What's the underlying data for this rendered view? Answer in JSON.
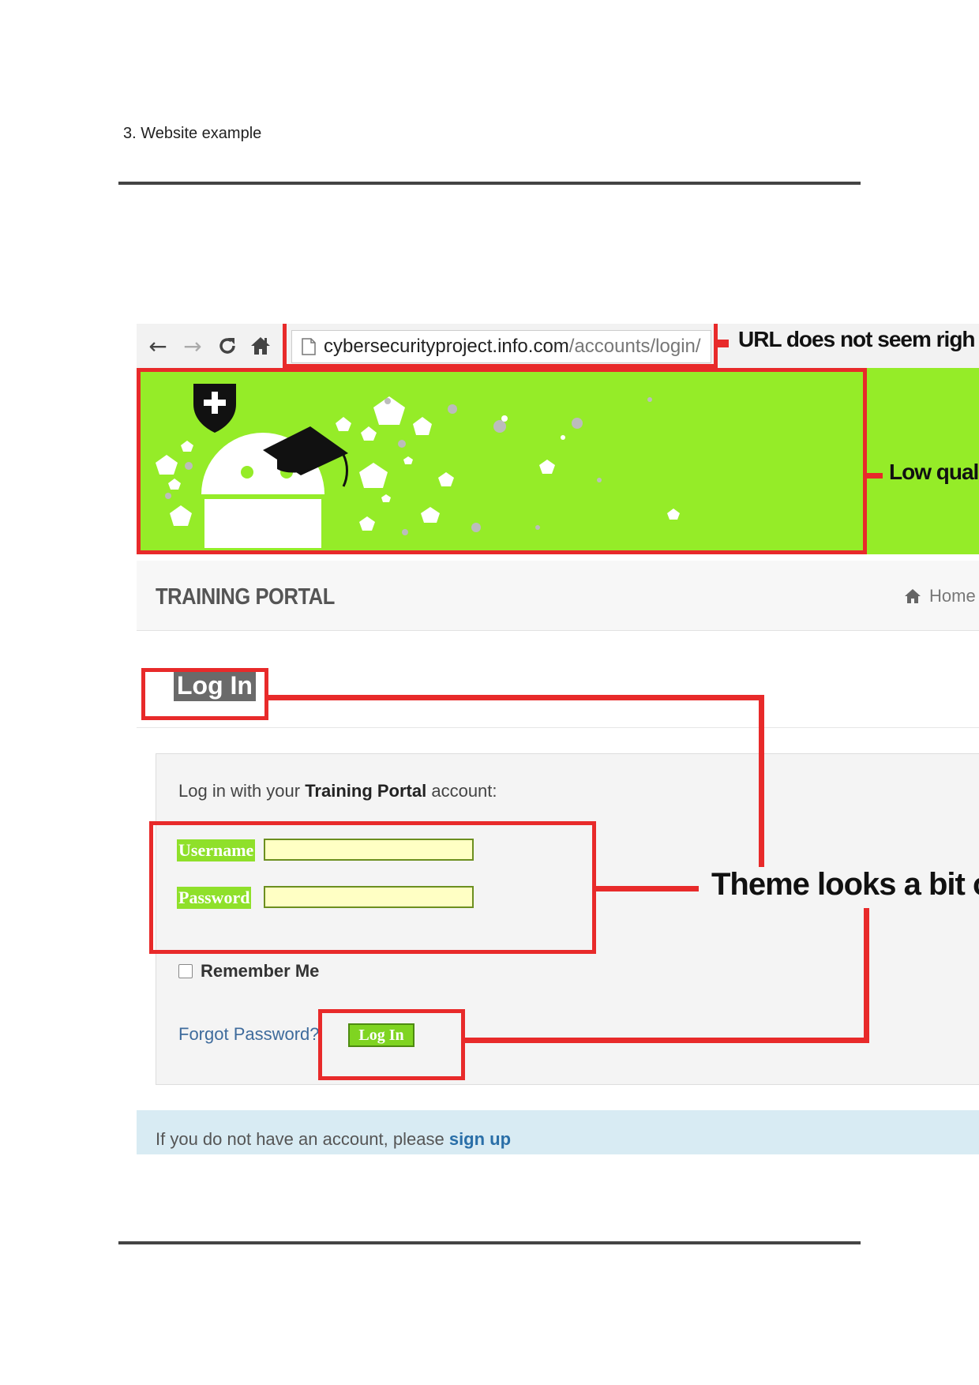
{
  "document": {
    "heading": "3. Website example"
  },
  "browser": {
    "url_host": "cybersecurityproject.info.com",
    "url_path": "/accounts/login/"
  },
  "portal": {
    "title": "TRAINING PORTAL",
    "home_link": "Home"
  },
  "login": {
    "heading": "Log In",
    "prompt_prefix": "Log in with your ",
    "prompt_bold": "Training Portal",
    "prompt_suffix": " account:",
    "username_label": "Username",
    "password_label": "Password",
    "username_value": "",
    "password_value": "",
    "remember_label": "Remember Me",
    "remember_checked": false,
    "forgot_label": "Forgot Password?",
    "button_label": "Log In"
  },
  "signup": {
    "text": "If you do not have an account, please ",
    "link": "sign up"
  },
  "annotations": {
    "url": "URL does not seem righ",
    "banner": "Low qual",
    "theme": "Theme looks a bit o"
  },
  "colors": {
    "annotation_red": "#e82a2a",
    "banner_green": "#95ec28",
    "field_yellow": "#ffffc4",
    "link_blue": "#3e6b9c"
  }
}
